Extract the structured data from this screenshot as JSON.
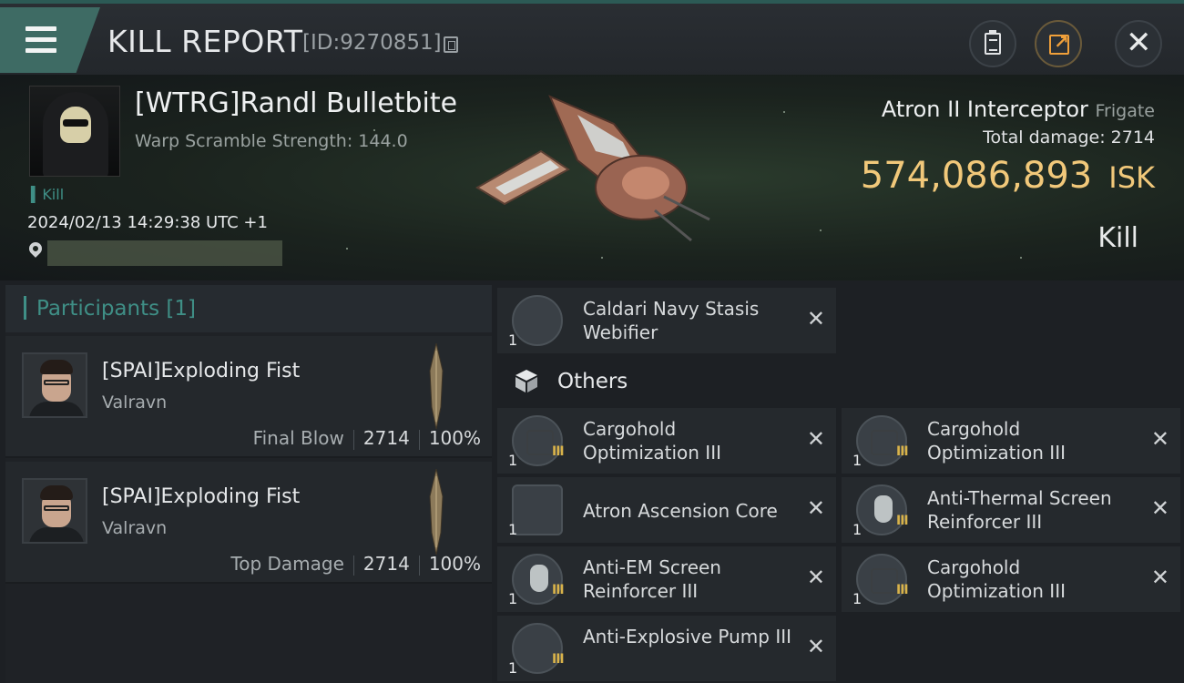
{
  "header": {
    "title": "KILL REPORT",
    "report_id": "[ID:9270851]"
  },
  "victim": {
    "name": "[WTRG]Randl Bulletbite",
    "warp_scramble": "Warp Scramble Strength: 144.0",
    "kill_tag": "Kill",
    "datetime": "2024/02/13 14:29:38 UTC +1",
    "ship_name": "Atron II Interceptor",
    "ship_class": "Frigate",
    "total_damage_label": "Total damage:",
    "total_damage": "2714",
    "isk_value": "574,086,893",
    "isk_unit": "ISK",
    "result": "Kill"
  },
  "participants": {
    "label": "Participants [1]",
    "rows": [
      {
        "name": "[SPAI]Exploding Fist",
        "corp": "Valravn",
        "role": "Final Blow",
        "damage": "2714",
        "percent": "100%"
      },
      {
        "name": "[SPAI]Exploding Fist",
        "corp": "Valravn",
        "role": "Top Damage",
        "damage": "2714",
        "percent": "100%"
      }
    ]
  },
  "items": {
    "top": {
      "name": "Caldari Navy Stasis Webifier",
      "qty": "1",
      "icon": "stasis-webifier-icon"
    },
    "others_label": "Others",
    "others": [
      {
        "name": "Cargohold Optimization III",
        "qty": "1",
        "tech": "III",
        "icon": "cargohold-icon"
      },
      {
        "name": "Cargohold Optimization III",
        "qty": "1",
        "tech": "III",
        "icon": "cargohold-icon"
      },
      {
        "name": "Atron Ascension Core",
        "qty": "1",
        "tech": "",
        "icon": "ascension-core-icon"
      },
      {
        "name": "Anti-Thermal Screen Reinforcer III",
        "qty": "1",
        "tech": "III",
        "icon": "shield-rig-icon"
      },
      {
        "name": "Anti-EM Screen Reinforcer III",
        "qty": "1",
        "tech": "III",
        "icon": "shield-rig-icon"
      },
      {
        "name": "Cargohold Optimization III",
        "qty": "1",
        "tech": "III",
        "icon": "cargohold-icon"
      },
      {
        "name": "Anti-Explosive Pump III",
        "qty": "1",
        "tech": "III",
        "icon": "armor-pump-icon"
      }
    ]
  },
  "colors": {
    "accent": "#3f8f86",
    "isk": "#f1c87a",
    "tech": "#d9b34a"
  }
}
